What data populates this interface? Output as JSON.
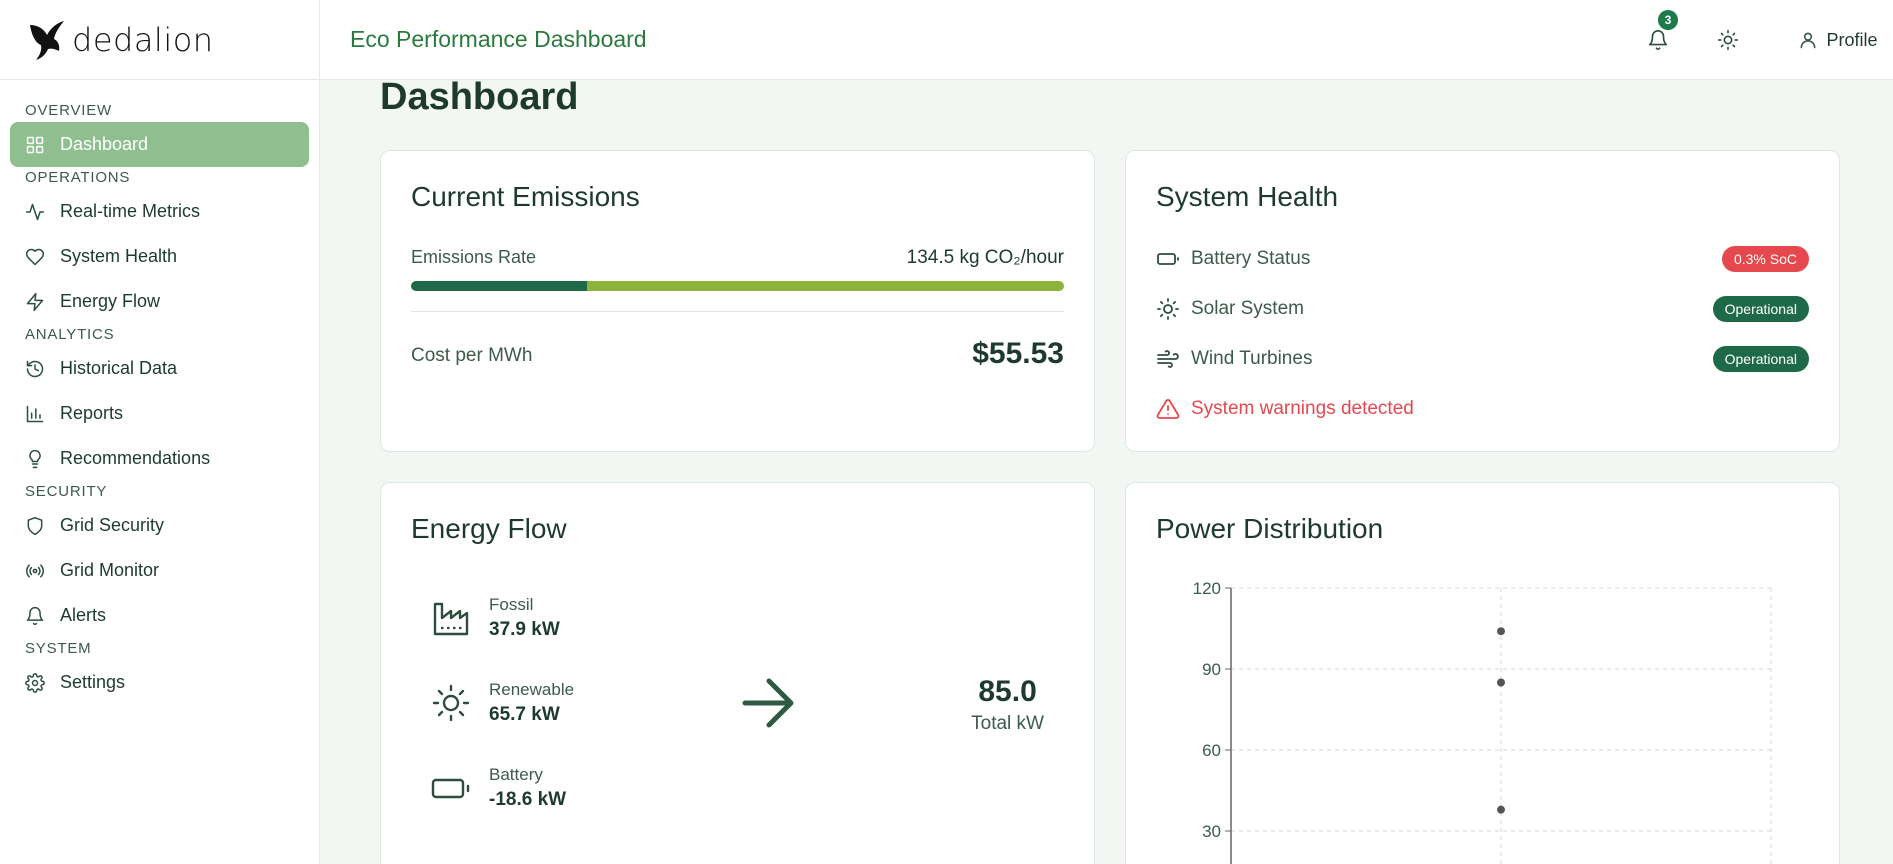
{
  "brand": {
    "name": "dedalion"
  },
  "sidebar": {
    "sections": [
      {
        "label": "OVERVIEW",
        "items": [
          {
            "label": "Dashboard",
            "icon": "grid-icon",
            "active": true
          }
        ]
      },
      {
        "label": "OPERATIONS",
        "items": [
          {
            "label": "Real-time Metrics",
            "icon": "activity-icon"
          },
          {
            "label": "System Health",
            "icon": "heart-icon"
          },
          {
            "label": "Energy Flow",
            "icon": "zap-icon"
          }
        ]
      },
      {
        "label": "ANALYTICS",
        "items": [
          {
            "label": "Historical Data",
            "icon": "history-icon"
          },
          {
            "label": "Reports",
            "icon": "bar-chart-icon"
          },
          {
            "label": "Recommendations",
            "icon": "lightbulb-icon"
          }
        ]
      },
      {
        "label": "SECURITY",
        "items": [
          {
            "label": "Grid Security",
            "icon": "shield-icon"
          },
          {
            "label": "Grid Monitor",
            "icon": "radio-icon"
          },
          {
            "label": "Alerts",
            "icon": "bell-icon"
          }
        ]
      },
      {
        "label": "SYSTEM",
        "items": [
          {
            "label": "Settings",
            "icon": "gear-icon"
          }
        ]
      }
    ]
  },
  "header": {
    "title": "Eco Performance Dashboard",
    "notifications_count": "3",
    "profile_label": "Profile"
  },
  "main": {
    "page_title": "Dashboard",
    "emissions": {
      "title": "Current Emissions",
      "rate_label": "Emissions Rate",
      "rate_value": "134.5 kg CO₂/hour",
      "rate_fraction": 0.27,
      "cost_label": "Cost per MWh",
      "cost_value": "$55.53"
    },
    "health": {
      "title": "System Health",
      "rows": [
        {
          "label": "Battery Status",
          "badge": "0.3% SoC",
          "status": "red",
          "icon": "battery-icon"
        },
        {
          "label": "Solar System",
          "badge": "Operational",
          "status": "green",
          "icon": "sun-icon"
        },
        {
          "label": "Wind Turbines",
          "badge": "Operational",
          "status": "green",
          "icon": "wind-icon"
        }
      ],
      "warning": "System warnings detected"
    },
    "energy_flow": {
      "title": "Energy Flow",
      "sources": [
        {
          "name": "Fossil",
          "value": "37.9 kW",
          "icon": "factory-icon"
        },
        {
          "name": "Renewable",
          "value": "65.7 kW",
          "icon": "sun-icon"
        },
        {
          "name": "Battery",
          "value": "-18.6 kW",
          "icon": "battery-icon"
        }
      ],
      "total_value": "85.0",
      "total_label": "Total kW"
    },
    "power_distribution": {
      "title": "Power Distribution"
    }
  },
  "chart_data": {
    "type": "scatter",
    "title": "Power Distribution",
    "yticks": [
      30,
      60,
      90,
      120
    ],
    "ylim": [
      0,
      120
    ],
    "grid": true,
    "points": [
      {
        "x": 1,
        "y": 104
      },
      {
        "x": 1,
        "y": 85
      },
      {
        "x": 1,
        "y": 37.9
      }
    ]
  }
}
